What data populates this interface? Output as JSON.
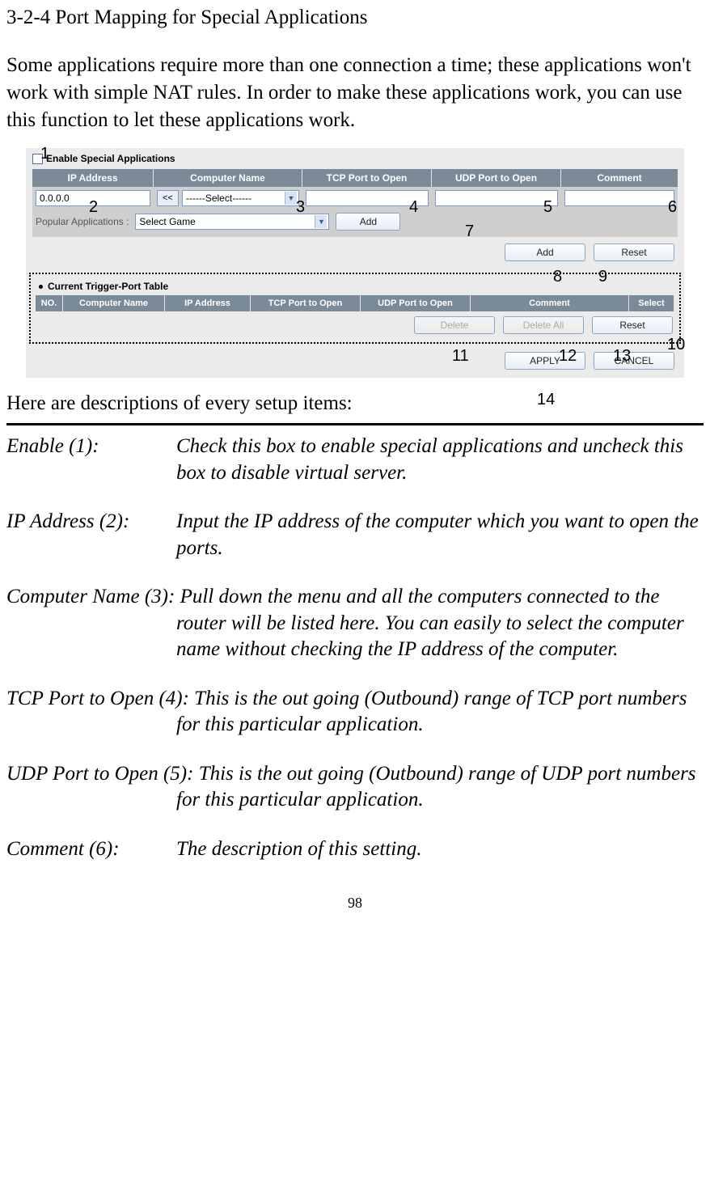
{
  "title": "3-2-4 Port Mapping for Special Applications",
  "intro": "Some applications require more than one connection a time; these applications won't work with simple NAT rules. In order to make these applications work, you can use this function to let these applications work.",
  "enable_label": "Enable Special Applications",
  "headers": {
    "ip": "IP Address",
    "cn": "Computer Name",
    "tcp": "TCP Port to Open",
    "udp": "UDP Port to Open",
    "cmt": "Comment"
  },
  "ip_value": "0.0.0.0",
  "copy_btn": "<<",
  "select_placeholder": "------Select------",
  "popular_label": "Popular Applications  :",
  "popular_value": "Select Game",
  "btn_add": "Add",
  "btn_reset": "Reset",
  "table_title": "Current Trigger-Port Table",
  "tbl_headers": {
    "no": "NO.",
    "cn": "Computer Name",
    "ip": "IP Address",
    "tcp": "TCP Port to Open",
    "udp": "UDP Port to Open",
    "cmt": "Comment",
    "sel": "Select"
  },
  "btn_delete": "Delete",
  "btn_delete_all": "Delete All",
  "btn_apply": "APPLY",
  "btn_cancel": "CANCEL",
  "callouts": {
    "n1": "1",
    "n2": "2",
    "n3": "3",
    "n4": "4",
    "n5": "5",
    "n6": "6",
    "n7": "7",
    "n8": "8",
    "n9": "9",
    "n10": "10",
    "n11": "11",
    "n12": "12",
    "n13": "13",
    "n14": "14"
  },
  "desc_heading": "Here are descriptions of every setup items:",
  "descriptions": [
    {
      "label": "Enable (1):",
      "text": "Check this box to enable special applications and uncheck this box to disable virtual server."
    },
    {
      "label": "IP Address (2):",
      "text": "Input the IP address of the computer which you want to open the ports."
    },
    {
      "label": "Computer Name (3):",
      "text": "Pull down the menu and all the computers connected to the router will be listed here. You can easily to select the computer name without checking the IP address of the computer.",
      "inline": true
    },
    {
      "label": "TCP Port to Open (4):",
      "text": "This is the out going (Outbound) range of TCP port numbers for this particular application.",
      "inline": true
    },
    {
      "label": "UDP Port to Open (5):",
      "text": "This is the out going (Outbound) range of UDP port numbers for this particular application.",
      "inline": true
    },
    {
      "label": "Comment (6):",
      "text": "The description of this setting."
    }
  ],
  "page_number": "98"
}
